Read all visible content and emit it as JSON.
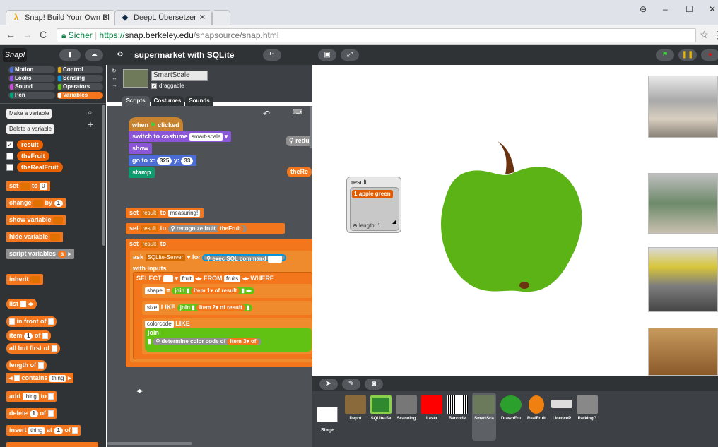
{
  "browser": {
    "tabs": [
      {
        "title": "Snap! Build Your Own Bl",
        "active": true
      },
      {
        "title": "DeepL Übersetzer",
        "active": false
      }
    ],
    "address": {
      "security": "Sicher",
      "url_scheme": "https://",
      "url_host": "snap.berkeley.edu",
      "url_path": "/snapsource/snap.html"
    }
  },
  "snap": {
    "logo": "Snap!",
    "project_name": "supermarket with SQLite",
    "categories": [
      "Motion",
      "Control",
      "Looks",
      "Sensing",
      "Sound",
      "Operators",
      "Pen",
      "Variables"
    ],
    "category_colors": {
      "Motion": "#4a6cd4",
      "Control": "#e6a822",
      "Looks": "#8f56e3",
      "Sensing": "#0494dc",
      "Sound": "#cf4ad9",
      "Operators": "#62c213",
      "Pen": "#00a178",
      "Variables": "#f3761d"
    },
    "palette": {
      "make_variable": "Make a variable",
      "delete_variable": "Delete a variable",
      "variables": [
        {
          "name": "result",
          "checked": true
        },
        {
          "name": "theFruit",
          "checked": false
        },
        {
          "name": "theRealFruit",
          "checked": false
        }
      ],
      "blocks": {
        "set": "set",
        "to": "to",
        "set_val": "0",
        "change": "change",
        "by": "by",
        "change_val": "1",
        "show_variable": "show variable",
        "hide_variable": "hide variable",
        "script_variables": "script variables",
        "script_var_a": "a",
        "inherit": "inherit",
        "list": "list",
        "in_front_of": "in front of",
        "item": "item",
        "item_val": "1",
        "of": "of",
        "all_but_first_of": "all but first of",
        "length_of": "length of",
        "contains": "contains",
        "thing": "thing",
        "add": "add",
        "add_thing": "thing",
        "add_to": "to",
        "delete": "delete",
        "delete_val": "1",
        "delete_of": "of",
        "insert": "insert",
        "insert_thing": "thing",
        "insert_at": "at",
        "insert_val": "1",
        "insert_of": "of"
      }
    },
    "sprite": {
      "name": "SmartScale",
      "draggable_label": "draggable",
      "tabs": [
        "Scripts",
        "Costumes",
        "Sounds"
      ]
    },
    "script": {
      "when": "when",
      "clicked": "clicked",
      "switch_costume": "switch to costume",
      "costume": "smart-scale",
      "show": "show",
      "goto": "go to x:",
      "x": "325",
      "y_label": "y:",
      "y": "33",
      "stamp": "stamp",
      "set": "set",
      "result": "result",
      "to": "to",
      "measuring": "measuring!",
      "recognize_fruit": "recognize fruit",
      "the_fruit": "theFruit",
      "ask": "ask",
      "sqlite_server": "SQLite-Server",
      "for": "for",
      "exec_sql": "exec SQL command",
      "with_inputs": "with inputs",
      "select": "SELECT",
      "fruit": "fruit",
      "from": "FROM",
      "fruits": "fruits",
      "where": "WHERE",
      "shape": "shape",
      "eq": "=",
      "join": "join",
      "item": "item",
      "one": "1",
      "of": "of",
      "size": "size",
      "like": "LIKE",
      "two": "2",
      "colorcode": "colorcode",
      "colorcode_like": "LIKE",
      "join2": "join",
      "determine_color": "determine color code of",
      "three": "3",
      "redu_peek": "redu",
      "thereal_peek": "theRe"
    },
    "watcher": {
      "label": "result",
      "index": "1",
      "item": "apple green",
      "length_label": "length: 1"
    },
    "sprites": [
      {
        "name": "Depot",
        "color": "#8a6a3a"
      },
      {
        "name": "SQLite-Se",
        "color": "#2f8a2f"
      },
      {
        "name": "Scanning",
        "color": "#777777"
      },
      {
        "name": "Laser",
        "color": "#ff0000"
      },
      {
        "name": "Barcode",
        "color": "#ffffff"
      },
      {
        "name": "SmartSca",
        "color": "#6a7a5a",
        "selected": true
      },
      {
        "name": "DrawnFru",
        "color": "#2ca02c"
      },
      {
        "name": "RealFruit",
        "color": "#f08010"
      },
      {
        "name": "LicenceP",
        "color": "#dddddd"
      },
      {
        "name": "ParkingG",
        "color": "#888888"
      }
    ],
    "stage_label": "Stage"
  }
}
